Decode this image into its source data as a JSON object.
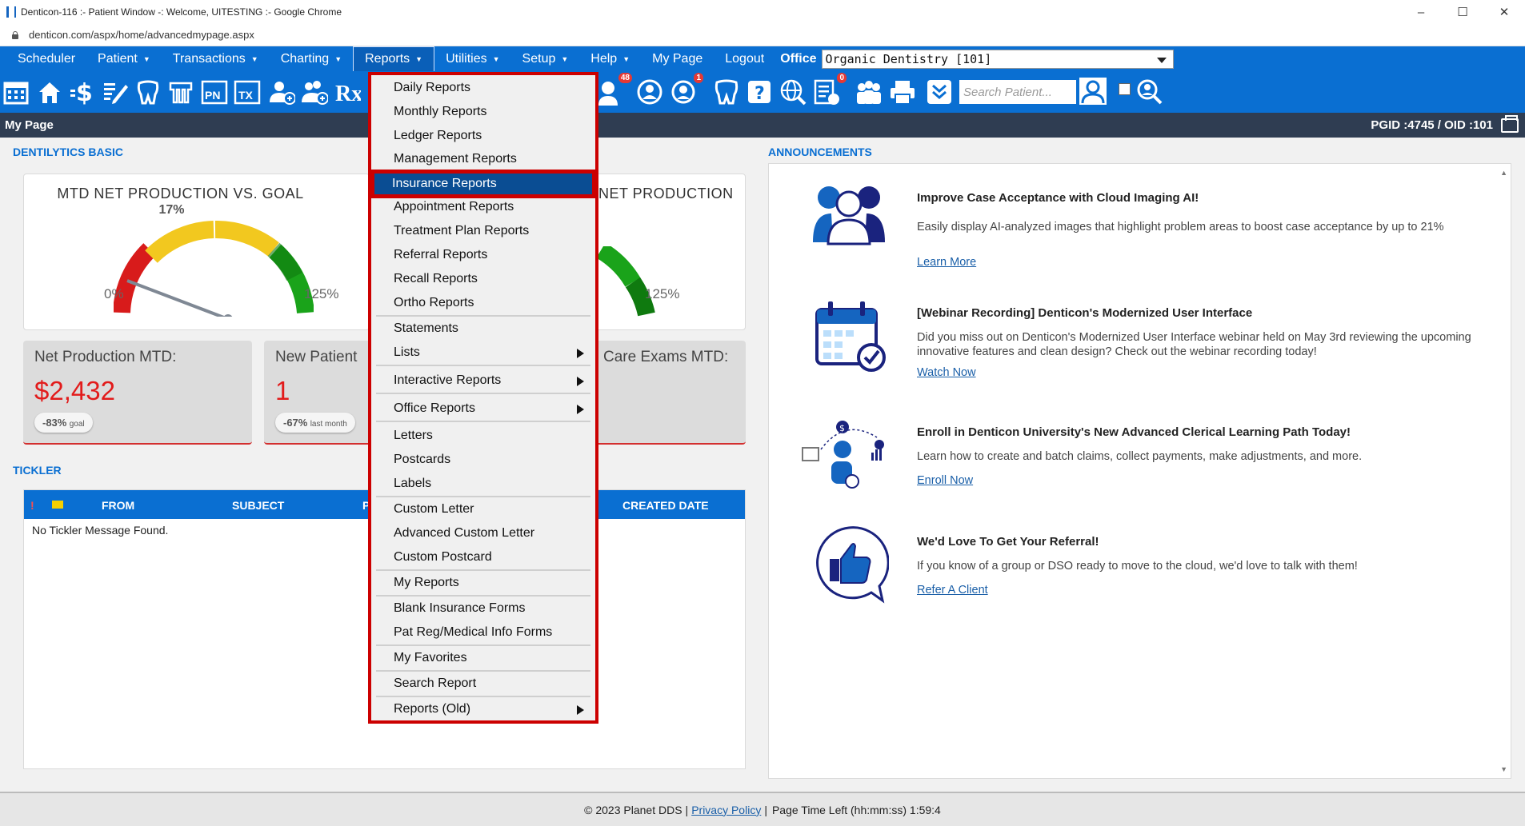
{
  "window": {
    "title": "Denticon-116 :- Patient Window -: Welcome, UITESTING :- Google Chrome",
    "url": "denticon.com/aspx/home/advancedmypage.aspx",
    "controls": [
      "–",
      "☐",
      "✕"
    ]
  },
  "menubar": {
    "items": [
      {
        "label": "Scheduler",
        "caret": false
      },
      {
        "label": "Patient",
        "caret": true
      },
      {
        "label": "Transactions",
        "caret": true
      },
      {
        "label": "Charting",
        "caret": true
      },
      {
        "label": "Reports",
        "caret": true
      },
      {
        "label": "Utilities",
        "caret": true
      },
      {
        "label": "Setup",
        "caret": true
      },
      {
        "label": "Help",
        "caret": true
      },
      {
        "label": "My Page",
        "caret": false
      },
      {
        "label": "Logout",
        "caret": false
      }
    ],
    "caret_glyph": "▼",
    "office_label": "Office",
    "office_value": "Organic Dentistry [101]"
  },
  "toolbar": {
    "icons": [
      "calendar-icon",
      "home-icon",
      "dollar-icon",
      "edit-chart-icon",
      "tooth-icon",
      "teeth-icon",
      "pn-icon",
      "tx-icon",
      "add-patient-icon",
      "add-family-icon",
      "rx-icon",
      "medical-alerts-icon",
      "treatment-icon",
      "tooth-outline-icon",
      "tooth-question-icon",
      "globe-search-icon",
      "eligibility-icon",
      "family-icon",
      "print-icon",
      "collapse-icon",
      "patient-search-icon"
    ],
    "pn_text": "PN",
    "tx_text": "TX",
    "rx_text": "Rx",
    "badge_48": "48",
    "badge_1": "1",
    "badge_0": "0",
    "search_placeholder": "Search Patient..."
  },
  "pagebar": {
    "title": "My Page",
    "ids": "PGID :4745  /  OID :101"
  },
  "dentilytics": {
    "section_title": "DENTILYTICS BASIC",
    "gauge1": {
      "title": "MTD NET PRODUCTION VS. GOAL",
      "percent": "17%",
      "min": "0%",
      "max": "125%",
      "value_pct": 17
    },
    "gauge2": {
      "title_visible": "NET PRODUCTION",
      "max": "125%"
    },
    "cards": [
      {
        "label": "Net Production MTD:",
        "value": "$2,432",
        "pill_pct": "-83%",
        "pill_note": "goal"
      },
      {
        "label": "New Patient",
        "value": "1",
        "pill_pct": "-67%",
        "pill_note": "last month"
      },
      {
        "label": "Care Exams MTD:"
      }
    ]
  },
  "tickler": {
    "section_title": "TICKLER",
    "flag": "!",
    "columns": {
      "from": "FROM",
      "subject": "SUBJECT",
      "p": "P",
      "created": "CREATED DATE"
    },
    "empty_message": "No Tickler Message Found."
  },
  "announcements": {
    "section_title": "ANNOUNCEMENTS",
    "items": [
      {
        "icon": "people-group-icon",
        "title": "Improve Case Acceptance with Cloud Imaging AI!",
        "body": "Easily display AI-analyzed images that highlight problem areas to boost case acceptance by up to 21%",
        "link": "Learn More"
      },
      {
        "icon": "calendar-check-icon",
        "title": "[Webinar Recording] Denticon's Modernized User Interface",
        "body": "Did you miss out on Denticon's Modernized User Interface webinar held on May 3rd reviewing the upcoming innovative features and clean design? Check out the webinar recording today!",
        "link": "Watch Now"
      },
      {
        "icon": "learning-path-icon",
        "title": "Enroll in Denticon University's New Advanced Clerical Learning Path Today!",
        "body": "Learn how to create and batch claims, collect payments, make adjustments, and more.",
        "link": "Enroll Now"
      },
      {
        "icon": "thumbs-up-icon",
        "title": "We'd Love To Get Your Referral!",
        "body": "If you know of a group or DSO ready to move to the cloud, we'd love to talk with them!",
        "link": "Refer A Client"
      }
    ]
  },
  "reports_menu": {
    "items": [
      {
        "label": "Daily Reports"
      },
      {
        "label": "Monthly Reports"
      },
      {
        "label": "Ledger Reports"
      },
      {
        "label": "Management Reports"
      },
      {
        "label": "Insurance Reports",
        "highlighted": true
      },
      {
        "label": "Appointment Reports"
      },
      {
        "label": "Treatment Plan Reports"
      },
      {
        "label": "Referral Reports"
      },
      {
        "label": "Recall Reports"
      },
      {
        "label": "Ortho Reports"
      },
      {
        "label": "Statements"
      },
      {
        "label": "Lists",
        "submenu": true
      },
      {
        "label": "Interactive Reports",
        "submenu": true
      },
      {
        "label": "Office Reports",
        "submenu": true
      },
      {
        "label": "Letters"
      },
      {
        "label": "Postcards"
      },
      {
        "label": "Labels"
      },
      {
        "label": "Custom Letter"
      },
      {
        "label": "Advanced Custom Letter"
      },
      {
        "label": "Custom Postcard"
      },
      {
        "label": "My Reports"
      },
      {
        "label": "Blank Insurance Forms"
      },
      {
        "label": "Pat Reg/Medical Info Forms"
      },
      {
        "label": "My Favorites"
      },
      {
        "label": "Search Report"
      },
      {
        "label": "Reports (Old)",
        "submenu": true
      }
    ]
  },
  "footer": {
    "copyright": "© 2023 Planet DDS",
    "sep1": "|",
    "privacy": "Privacy Policy",
    "sep2": "|",
    "time_left": "Page Time Left (hh:mm:ss) 1:59:4"
  },
  "colors": {
    "brand_blue": "#0a6fd2",
    "menu_highlight_red": "#cc0000",
    "value_red": "#e21b1b"
  }
}
